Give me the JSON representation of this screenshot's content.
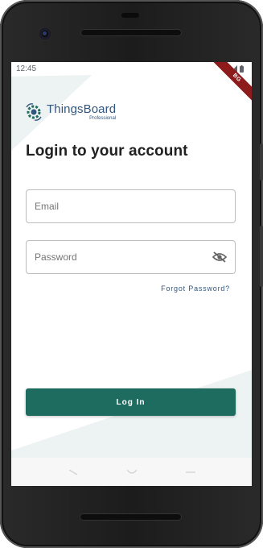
{
  "status_bar": {
    "time": "12:45",
    "icons": [
      "wifi-icon",
      "signal-icon",
      "battery-icon"
    ]
  },
  "debug_banner": {
    "label": "BG"
  },
  "brand": {
    "name": "ThingsBoard",
    "edition": "Professional",
    "logo_icon": "thingsboard-logo-icon",
    "color": "#305680"
  },
  "login": {
    "title": "Login to your account",
    "email_placeholder": "Email",
    "password_placeholder": "Password",
    "password_toggle_icon": "eye-off-icon",
    "forgot_password": "Forgot Password?",
    "submit_label": "Log In",
    "button_color": "#1e6b5f"
  },
  "nav_bar": {
    "items": [
      "back-icon",
      "home-icon",
      "recents-icon"
    ]
  }
}
